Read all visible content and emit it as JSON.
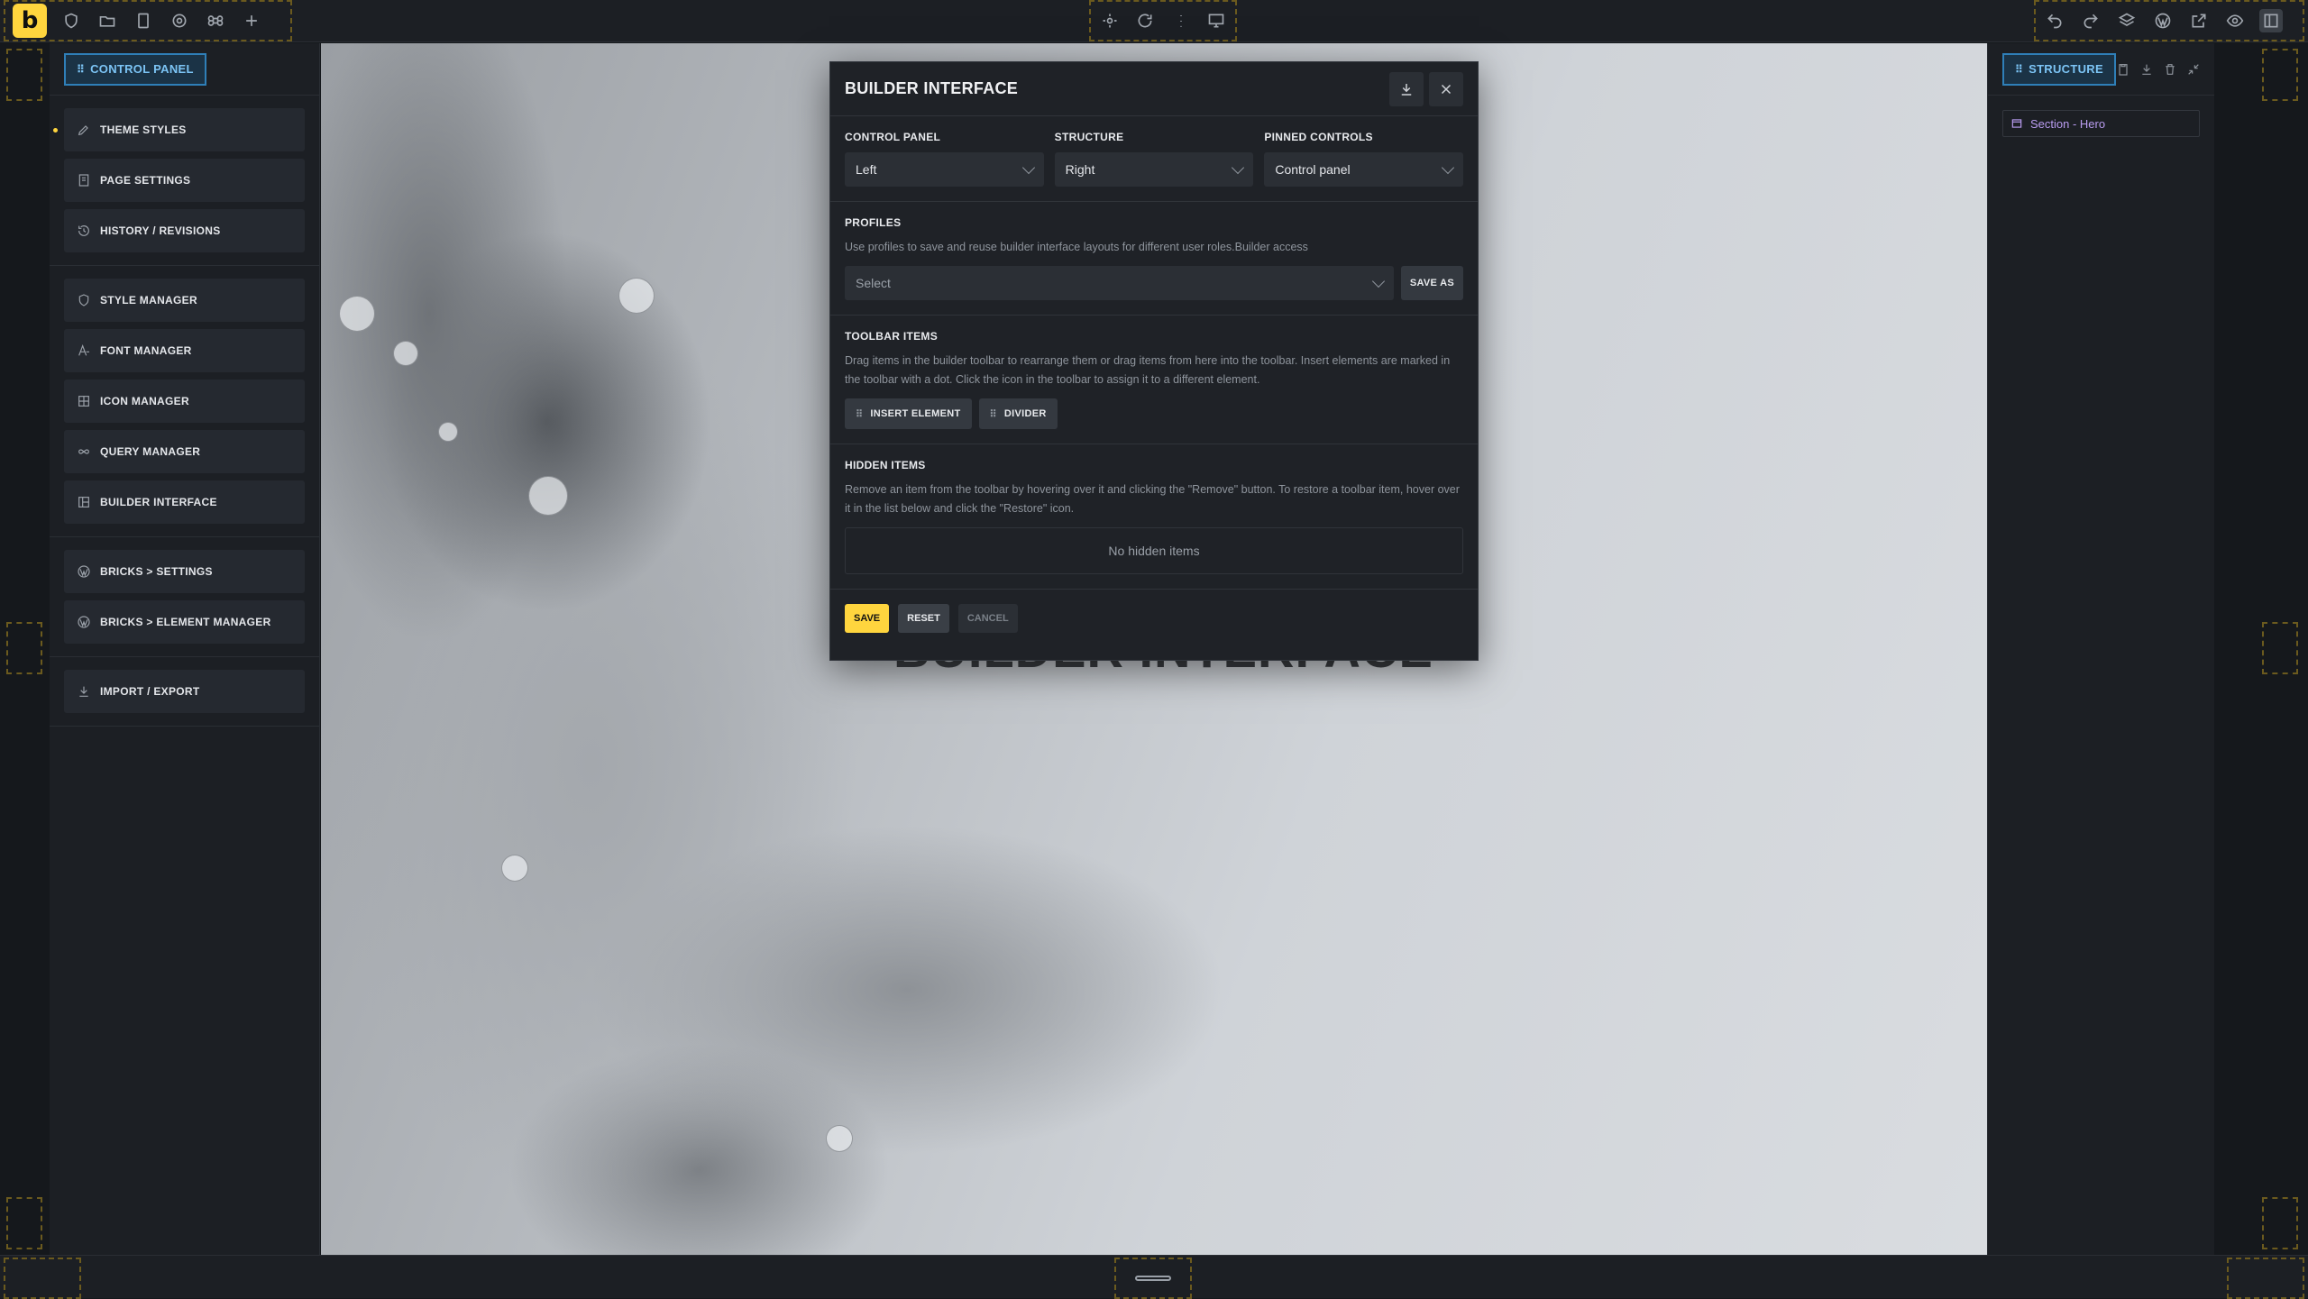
{
  "colors": {
    "accent": "#ffd53e",
    "structure_accent": "#2f7fb8",
    "element_label": "#b99cf0"
  },
  "topbar": {
    "logo": "b",
    "left_icons": [
      "shield-icon",
      "folder-icon",
      "pages-icon",
      "gear-icon",
      "command-icon",
      "plus-icon"
    ],
    "center_icons": [
      "sun-icon",
      "refresh-icon",
      "more-vertical-icon",
      "desktop-icon"
    ],
    "right_icons": [
      "undo-icon",
      "redo-icon",
      "layers-icon",
      "wordpress-icon",
      "external-link-icon",
      "eye-icon",
      "panel-icon"
    ]
  },
  "control_panel": {
    "tab_label": "CONTROL PANEL",
    "groups": [
      [
        {
          "label": "THEME STYLES",
          "icon": "brush-icon",
          "active_dot": true
        },
        {
          "label": "PAGE SETTINGS",
          "icon": "document-icon"
        },
        {
          "label": "HISTORY / REVISIONS",
          "icon": "history-icon"
        }
      ],
      [
        {
          "label": "STYLE MANAGER",
          "icon": "shield-icon"
        },
        {
          "label": "FONT MANAGER",
          "icon": "font-icon"
        },
        {
          "label": "ICON MANAGER",
          "icon": "grid-icon"
        },
        {
          "label": "QUERY MANAGER",
          "icon": "infinity-icon"
        },
        {
          "label": "BUILDER INTERFACE",
          "icon": "layout-icon"
        }
      ],
      [
        {
          "label": "BRICKS > SETTINGS",
          "icon": "wordpress-icon"
        },
        {
          "label": "BRICKS > ELEMENT MANAGER",
          "icon": "wordpress-icon"
        }
      ],
      [
        {
          "label": "IMPORT / EXPORT",
          "icon": "download-icon"
        }
      ]
    ]
  },
  "structure": {
    "tab_label": "STRUCTURE",
    "items": [
      {
        "label": "Section - Hero"
      }
    ]
  },
  "canvas": {
    "hero_title": "BUILDER INTERFACE"
  },
  "modal": {
    "title": "BUILDER INTERFACE",
    "layout": {
      "control_panel_label": "CONTROL PANEL",
      "control_panel_value": "Left",
      "structure_label": "STRUCTURE",
      "structure_value": "Right",
      "pinned_label": "PINNED CONTROLS",
      "pinned_value": "Control panel"
    },
    "profiles": {
      "label": "PROFILES",
      "description": "Use profiles to save and reuse builder interface layouts for different user roles.Builder access",
      "select_placeholder": "Select",
      "save_as_label": "SAVE AS"
    },
    "toolbar_items": {
      "label": "TOOLBAR ITEMS",
      "description": "Drag items in the builder toolbar to rearrange them or drag items from here into the toolbar. Insert elements are marked in the toolbar with a dot. Click the icon in the toolbar to assign it to a different element.",
      "chips": [
        "INSERT ELEMENT",
        "DIVIDER"
      ]
    },
    "hidden_items": {
      "label": "HIDDEN ITEMS",
      "description": "Remove an item from the toolbar by hovering over it and clicking the \"Remove\" button. To restore a toolbar item, hover over it in the list below and click the \"Restore\" icon.",
      "empty_text": "No hidden items"
    },
    "footer": {
      "save": "SAVE",
      "reset": "RESET",
      "cancel": "CANCEL"
    }
  }
}
